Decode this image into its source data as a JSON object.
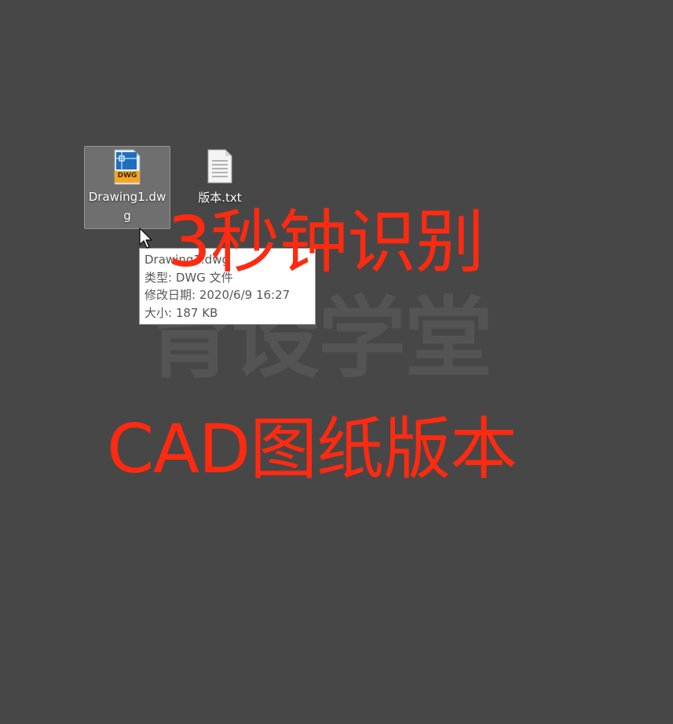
{
  "desktop": {
    "watermark_text": "育设学堂",
    "icons": [
      {
        "name": "Drawing1.dwg",
        "type_badge": "DWG",
        "selected": true
      },
      {
        "name": "版本.txt",
        "selected": false
      }
    ]
  },
  "tooltip": {
    "name_line": "Drawing1.dwg",
    "type_line": "类型: DWG 文件",
    "modified_line": "修改日期: 2020/6/9 16:27",
    "size_line": "大小: 187 KB"
  },
  "overlay": {
    "line1": "3秒钟识别",
    "line2": "CAD图纸版本",
    "color": "#ff2a10"
  },
  "colors": {
    "desktop_bg": "#474747",
    "dwg_badge": "#f5a623",
    "dwg_blue": "#1f6fc0"
  }
}
